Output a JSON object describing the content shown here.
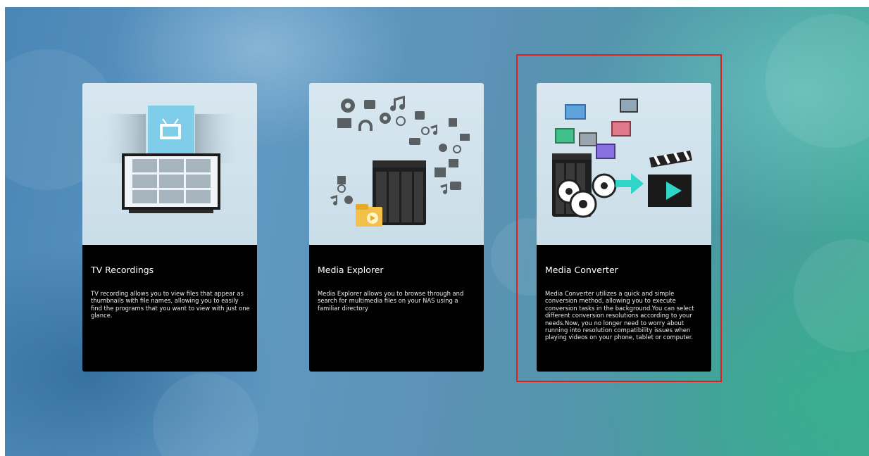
{
  "cards": [
    {
      "title": "TV Recordings",
      "description": "TV recording allows you to view files that appear as thumbnails with file names, allowing you to easily find the programs that you want to view with just one glance.",
      "illustration": "tv-thumbnails-icon"
    },
    {
      "title": "Media Explorer",
      "description": "Media Explorer allows you to browse through and search for multimedia files on your NAS using a familiar directory",
      "illustration": "nas-media-icons"
    },
    {
      "title": "Media Converter",
      "description": "Media Converter utilizes a quick and simple conversion method, allowing you to execute conversion tasks in the background.You can select different conversion resolutions according to your needs.Now, you no longer need to worry about running into resolution compatibility issues when playing videos on your phone, tablet or computer.",
      "illustration": "nas-gears-clapperboard-icon"
    }
  ],
  "highlight": {
    "target": "Media Converter",
    "color": "#e01e1e"
  },
  "colors": {
    "card_bg": "#000000",
    "illustration_bg": "#d4e4ed",
    "accent_cyan": "#2fd6c8"
  }
}
